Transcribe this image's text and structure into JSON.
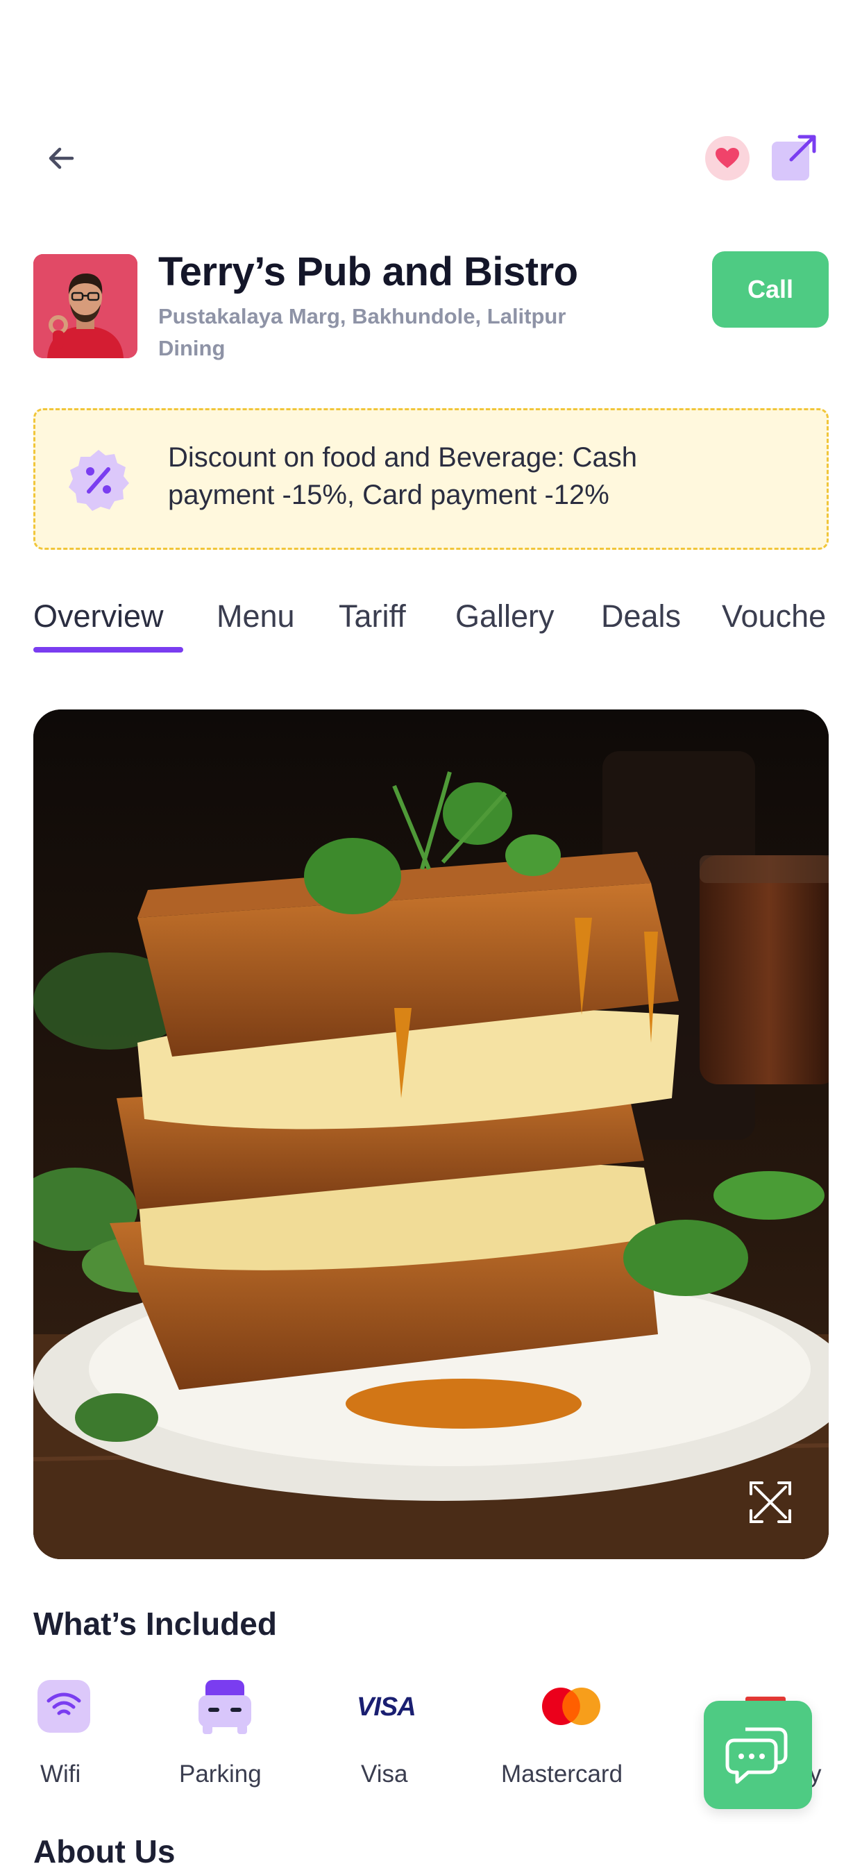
{
  "header": {
    "title": "Terry’s Pub and Bistro",
    "address": "Pustakalaya Marg, Bakhundole, Lalitpur",
    "category": "Dining",
    "call_label": "Call"
  },
  "icons": {
    "back": "arrow-left-icon",
    "favorite": "heart-icon",
    "share": "share-arrow-icon",
    "discount": "percent-badge-icon",
    "expand": "expand-icon",
    "chat": "chat-bubbles-icon"
  },
  "discount": {
    "line1": "Discount on food and Beverage: Cash",
    "line2": "payment -15%, Card payment -12%"
  },
  "tabs": [
    {
      "label": "Overview",
      "active": true
    },
    {
      "label": "Menu",
      "active": false
    },
    {
      "label": "Tariff",
      "active": false
    },
    {
      "label": "Gallery",
      "active": false
    },
    {
      "label": "Deals",
      "active": false
    },
    {
      "label": "Vouche",
      "active": false
    }
  ],
  "included": {
    "title": "What’s Included",
    "items": [
      {
        "label": "Wifi",
        "icon": "wifi-icon"
      },
      {
        "label": "Parking",
        "icon": "car-icon"
      },
      {
        "label": "Visa",
        "icon": "visa-logo-icon"
      },
      {
        "label": "Mastercard",
        "icon": "mastercard-logo-icon"
      },
      {
        "label": "y",
        "icon": "partial-icon"
      }
    ]
  },
  "about": {
    "title": "About Us"
  },
  "colors": {
    "accent": "#7a3df0",
    "call": "#4ecb83",
    "banner_bg": "#fff8dd",
    "banner_border": "#f1c63a",
    "heart": "#f0436a"
  },
  "brand": {
    "visa_text": "VISA"
  }
}
